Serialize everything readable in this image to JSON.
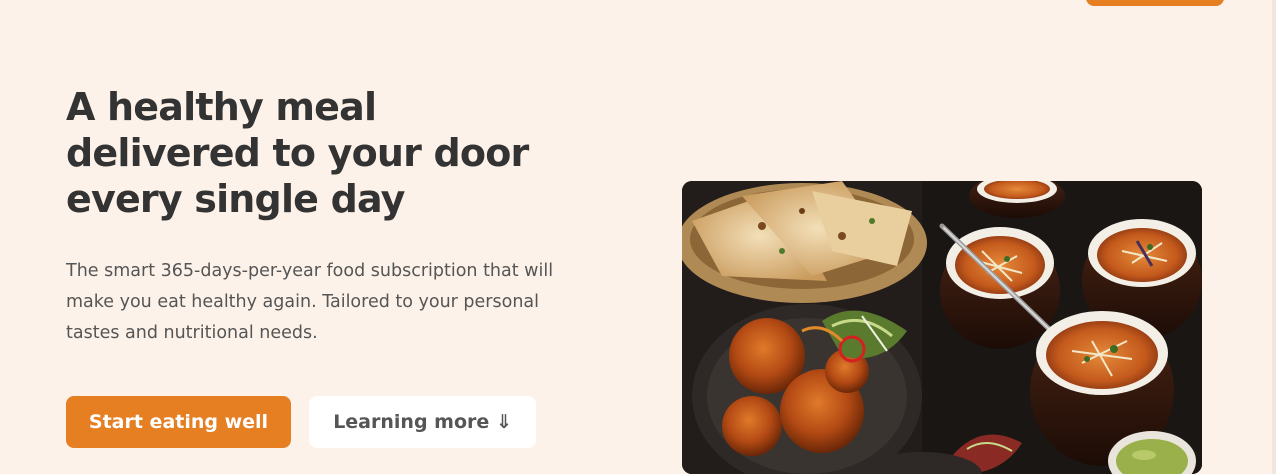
{
  "hero": {
    "title": "A healthy meal\ndelivered to your door\nevery single day",
    "description": "The smart 365-days-per-year food subscription that will make you eat healthy again. Tailored to your personal tastes and nutritional needs.",
    "cta_primary": "Start eating well",
    "cta_secondary": "Learning more ⇓"
  },
  "colors": {
    "background": "#fdf2e9",
    "accent": "#e67e22",
    "heading": "#333333",
    "body_text": "#555555"
  }
}
